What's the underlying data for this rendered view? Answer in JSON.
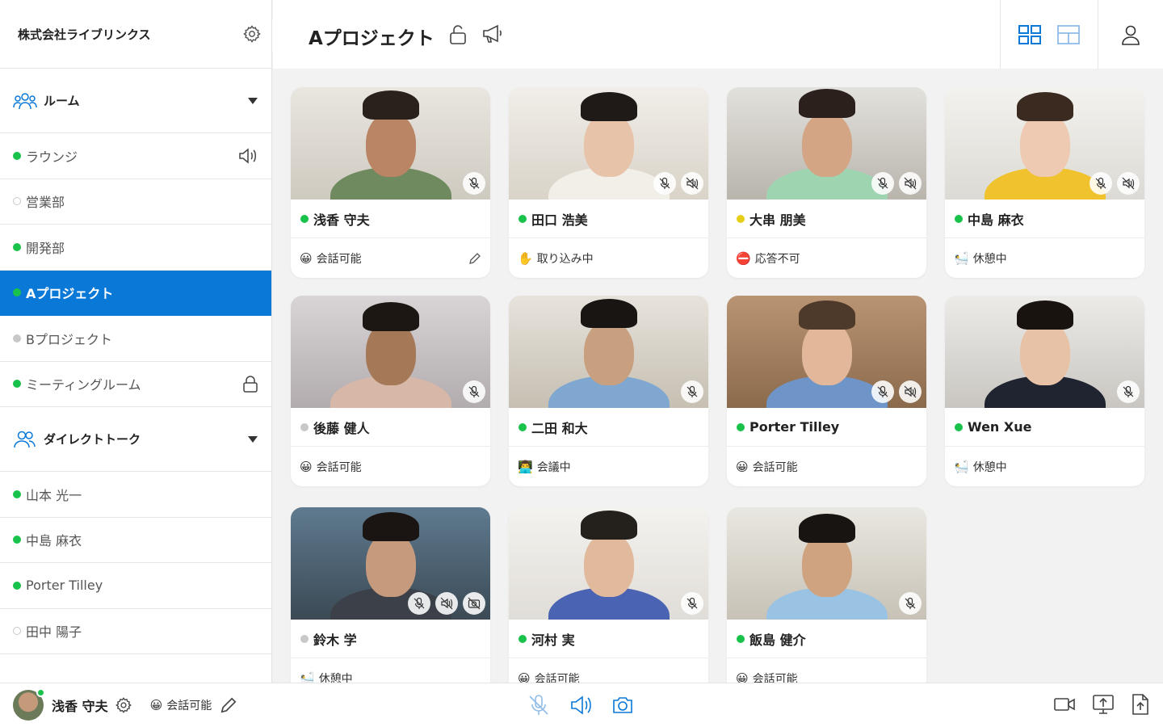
{
  "sidebar": {
    "org_name": "株式会社ライブリンクス",
    "rooms_label": "ルーム",
    "direct_label": "ダイレクトトーク",
    "rooms": [
      {
        "label": "ラウンジ",
        "status": "green"
      },
      {
        "label": "営業部",
        "status": "empty"
      },
      {
        "label": "開発部",
        "status": "green"
      },
      {
        "label": "Aプロジェクト",
        "status": "green"
      },
      {
        "label": "Bプロジェクト",
        "status": "grey"
      },
      {
        "label": "ミーティングルーム",
        "status": "green"
      }
    ],
    "direct": [
      {
        "label": "山本 光一",
        "status": "green"
      },
      {
        "label": "中島 麻衣",
        "status": "green"
      },
      {
        "label": "Porter Tilley",
        "status": "green"
      },
      {
        "label": "田中 陽子",
        "status": "empty"
      }
    ]
  },
  "topbar": {
    "title": "Aプロジェクト"
  },
  "colors": {
    "accent": "#0a78d7",
    "online": "#19c24b",
    "away": "#e6cf17",
    "offline": "#c8c8c8"
  },
  "members": [
    {
      "name": "浅香 守夫",
      "presence": "green",
      "emoji": "😀",
      "status": "会話可能"
    },
    {
      "name": "田口 浩美",
      "presence": "green",
      "emoji": "✋",
      "status": "取り込み中"
    },
    {
      "name": "大串 朋美",
      "presence": "yellow",
      "emoji": "⛔",
      "status": "応答不可"
    },
    {
      "name": "中島 麻衣",
      "presence": "green",
      "emoji": "🛀",
      "status": "休憩中"
    },
    {
      "name": "後藤 健人",
      "presence": "grey",
      "emoji": "😀",
      "status": "会話可能"
    },
    {
      "name": "二田 和大",
      "presence": "green",
      "emoji": "👨‍💻",
      "status": "会議中"
    },
    {
      "name": "Porter Tilley",
      "presence": "green",
      "emoji": "😀",
      "status": "会話可能"
    },
    {
      "name": "Wen Xue",
      "presence": "green",
      "emoji": "🛀",
      "status": "休憩中"
    },
    {
      "name": "鈴木 学",
      "presence": "grey",
      "emoji": "🛀",
      "status": "休憩中"
    },
    {
      "name": "河村 実",
      "presence": "green",
      "emoji": "😀",
      "status": "会話可能"
    },
    {
      "name": "飯島 健介",
      "presence": "green",
      "emoji": "😀",
      "status": "会話可能"
    }
  ],
  "me": {
    "name": "浅香 守夫",
    "emoji": "😀",
    "status": "会話可能"
  }
}
